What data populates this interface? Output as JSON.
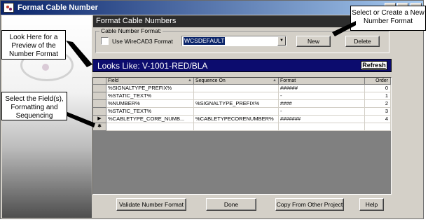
{
  "window": {
    "title": "Format Cable Number",
    "minimize": "_",
    "restore": "□",
    "close": "×"
  },
  "header": {
    "title": "Format Cable Numbers"
  },
  "format_group": {
    "title": "Cable Number Format:",
    "checkbox_label": "Use WireCAD3 Format",
    "checkbox_checked": false,
    "combo_value": "WCSDEFAULT",
    "combo_arrow": "▼",
    "new_button": "New",
    "delete_button": "Delete"
  },
  "preview": {
    "text": "Looks Like: V-1001-RED/BLA",
    "refresh_button": "Refresh"
  },
  "grid": {
    "columns": [
      "Field",
      "Sequence On",
      "Format",
      "Order"
    ],
    "sort_mark": "▲",
    "rows": [
      {
        "field": "%SIGNALTYPE_PREFIX%",
        "sequence_on": "",
        "format": "######",
        "order": "0",
        "marker": ""
      },
      {
        "field": "%STATIC_TEXT%",
        "sequence_on": "",
        "format": "-",
        "order": "1",
        "marker": ""
      },
      {
        "field": "%NUMBER%",
        "sequence_on": "%SIGNALTYPE_PREFIX%",
        "format": "####",
        "order": "2",
        "marker": ""
      },
      {
        "field": "%STATIC_TEXT%",
        "sequence_on": "",
        "format": "-",
        "order": "3",
        "marker": ""
      },
      {
        "field": "%CABLETYPE_CORE_NUMB...",
        "sequence_on": "%CABLETYPECORENUMBER%",
        "format": "#######",
        "order": "4",
        "marker": "▶"
      }
    ],
    "new_row_marker": "✱"
  },
  "buttons": {
    "validate": "Validate Number Format",
    "done": "Done",
    "copy": "Copy From Other Project",
    "help": "Help"
  },
  "callouts": {
    "preview_note": "Look Here for a Preview of the Number Format",
    "format_note": "Select or Create a New Number Format",
    "fields_note": "Select the Field(s), Formatting and Sequencing"
  }
}
